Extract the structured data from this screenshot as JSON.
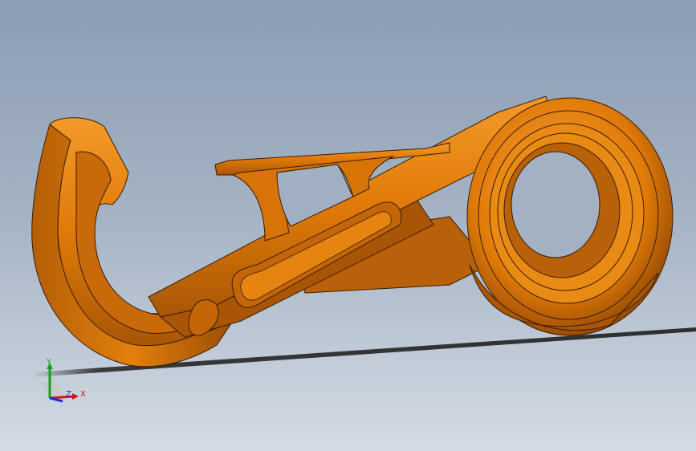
{
  "viewport": {
    "background_top": "#8c9db3",
    "background_bottom": "#d3dbe4"
  },
  "model": {
    "part_color": "#e6830a",
    "part_shadow": "#8a4703",
    "edge_color": "#3a1d00"
  },
  "triad": {
    "x_label": "X",
    "y_label": "Y",
    "z_label": "Z",
    "x_color": "#d01616",
    "y_color": "#15a015",
    "z_color": "#1b2fd0"
  }
}
